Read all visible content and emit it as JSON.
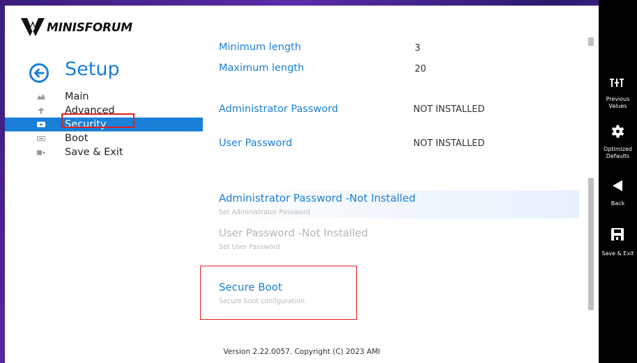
{
  "brand": {
    "name": "MINISFORUM"
  },
  "header": {
    "title": "Setup"
  },
  "nav": {
    "items": [
      {
        "label": "Main",
        "icon": "main-icon",
        "active": false
      },
      {
        "label": "Advanced",
        "icon": "advanced-icon",
        "active": false
      },
      {
        "label": "Security",
        "icon": "security-icon",
        "active": true
      },
      {
        "label": "Boot",
        "icon": "boot-icon",
        "active": false
      },
      {
        "label": "Save & Exit",
        "icon": "save-exit-icon",
        "active": false
      }
    ]
  },
  "settings": {
    "minimum_length": {
      "label": "Minimum length",
      "value": "3"
    },
    "maximum_length": {
      "label": "Maximum length",
      "value": "20"
    },
    "admin_password": {
      "label": "Administrator Password",
      "value": "NOT INSTALLED"
    },
    "user_password": {
      "label": "User Password",
      "value": "NOT INSTALLED"
    }
  },
  "links": {
    "admin": {
      "title": "Administrator Password -Not Installed",
      "description": "Set Administrator Password"
    },
    "user": {
      "title": "User Password -Not Installed",
      "description": "Set User Password"
    },
    "secure_boot": {
      "title": "Secure Boot",
      "description": "Secure boot configuration"
    }
  },
  "footer": {
    "version": "Version 2.22.0057. Copyright (C) 2023 AMI"
  },
  "toolbar": {
    "previous_values": {
      "line1": "Previous",
      "line2": "Values",
      "icon": "sliders-icon"
    },
    "optimized_defaults": {
      "line1": "Optimized",
      "line2": "Defaults",
      "icon": "gear-icon"
    },
    "back": {
      "label": "Back",
      "icon": "back-icon"
    },
    "save_exit": {
      "label": "Save & Exit",
      "icon": "floppy-icon"
    }
  },
  "colors": {
    "accent": "#1a7fd6",
    "highlight_border": "#e02020",
    "toolbar_bg": "#000000",
    "muted_text": "#b5b5b5"
  }
}
